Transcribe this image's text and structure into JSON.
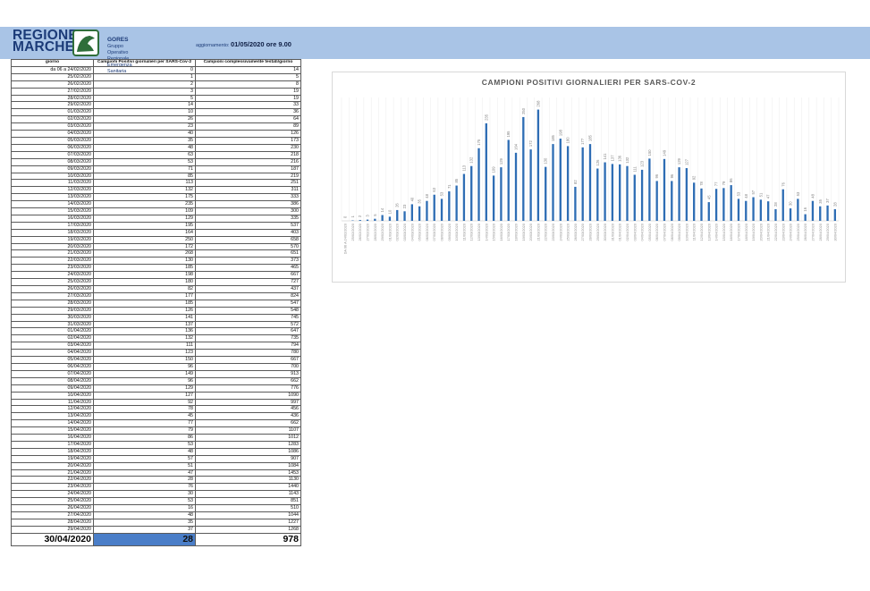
{
  "header": {
    "logo_line1": "REGIONE",
    "logo_line2": "MARCHE",
    "gores_bold": "GORES",
    "gores_rest": "Gruppo Operativo Regionale",
    "gores_line2": "Emergenza Sanitaria",
    "update_label": "aggiornamento:",
    "update_value": "01/05/2020 ore 9.00"
  },
  "colors": {
    "header_bg": "#a9c4e6",
    "bar": "#2e6db4",
    "highlight": "#4a7ec8",
    "logo_blue": "#1c3b78",
    "emblem_green": "#2f6e3a"
  },
  "table": {
    "headers": [
      "giorno",
      "Campioni Positivi giornalieri per SARS-Cov-2",
      "Campioni complessivamente testati/giorno"
    ],
    "rows": [
      [
        "da 06 a 24/02/2020",
        "0",
        "14"
      ],
      [
        "25/02/2020",
        "1",
        "5"
      ],
      [
        "26/02/2020",
        "2",
        "8"
      ],
      [
        "27/02/2020",
        "3",
        "19"
      ],
      [
        "28/02/2020",
        "5",
        "19"
      ],
      [
        "29/02/2020",
        "14",
        "33"
      ],
      [
        "01/03/2020",
        "10",
        "36"
      ],
      [
        "02/03/2020",
        "26",
        "64"
      ],
      [
        "03/03/2020",
        "23",
        "89"
      ],
      [
        "04/03/2020",
        "40",
        "126"
      ],
      [
        "05/03/2020",
        "35",
        "173"
      ],
      [
        "06/03/2020",
        "48",
        "230"
      ],
      [
        "07/03/2020",
        "63",
        "218"
      ],
      [
        "08/03/2020",
        "53",
        "216"
      ],
      [
        "09/03/2020",
        "71",
        "187"
      ],
      [
        "10/03/2020",
        "85",
        "219"
      ],
      [
        "11/03/2020",
        "113",
        "251"
      ],
      [
        "12/03/2020",
        "132",
        "311"
      ],
      [
        "13/03/2020",
        "175",
        "333"
      ],
      [
        "14/03/2020",
        "235",
        "386"
      ],
      [
        "15/03/2020",
        "109",
        "300"
      ],
      [
        "16/03/2020",
        "129",
        "335"
      ],
      [
        "17/03/2020",
        "195",
        "537"
      ],
      [
        "18/03/2020",
        "164",
        "403"
      ],
      [
        "19/03/2020",
        "250",
        "658"
      ],
      [
        "20/03/2020",
        "172",
        "570"
      ],
      [
        "21/03/2020",
        "268",
        "651"
      ],
      [
        "22/03/2020",
        "130",
        "373"
      ],
      [
        "23/03/2020",
        "185",
        "465"
      ],
      [
        "24/03/2020",
        "198",
        "667"
      ],
      [
        "25/03/2020",
        "180",
        "727"
      ],
      [
        "26/03/2020",
        "82",
        "437"
      ],
      [
        "27/03/2020",
        "177",
        "824"
      ],
      [
        "28/03/2020",
        "185",
        "547"
      ],
      [
        "29/03/2020",
        "126",
        "548"
      ],
      [
        "30/03/2020",
        "141",
        "745"
      ],
      [
        "31/03/2020",
        "137",
        "572"
      ],
      [
        "01/04/2020",
        "136",
        "647"
      ],
      [
        "02/04/2020",
        "132",
        "735"
      ],
      [
        "03/04/2020",
        "111",
        "794"
      ],
      [
        "04/04/2020",
        "123",
        "780"
      ],
      [
        "05/04/2020",
        "150",
        "667"
      ],
      [
        "06/04/2020",
        "96",
        "700"
      ],
      [
        "07/04/2020",
        "149",
        "913"
      ],
      [
        "08/04/2020",
        "96",
        "662"
      ],
      [
        "09/04/2020",
        "129",
        "776"
      ],
      [
        "10/04/2020",
        "127",
        "1090"
      ],
      [
        "11/04/2020",
        "92",
        "997"
      ],
      [
        "12/04/2020",
        "78",
        "456"
      ],
      [
        "13/04/2020",
        "45",
        "436"
      ],
      [
        "14/04/2020",
        "77",
        "662"
      ],
      [
        "15/04/2020",
        "79",
        "1107"
      ],
      [
        "16/04/2020",
        "86",
        "1012"
      ],
      [
        "17/04/2020",
        "53",
        "1283"
      ],
      [
        "18/04/2020",
        "48",
        "1086"
      ],
      [
        "19/04/2020",
        "57",
        "907"
      ],
      [
        "20/04/2020",
        "51",
        "1084"
      ],
      [
        "21/04/2020",
        "47",
        "1453"
      ],
      [
        "22/04/2020",
        "28",
        "1130"
      ],
      [
        "23/04/2020",
        "76",
        "1440"
      ],
      [
        "24/04/2020",
        "30",
        "1143"
      ],
      [
        "25/04/2020",
        "53",
        "851"
      ],
      [
        "26/04/2020",
        "16",
        "510"
      ],
      [
        "27/04/2020",
        "48",
        "1044"
      ],
      [
        "28/04/2020",
        "35",
        "1227"
      ],
      [
        "29/04/2020",
        "37",
        "1268"
      ]
    ],
    "last_row": [
      "30/04/2020",
      "28",
      "978"
    ]
  },
  "chart_data": {
    "type": "bar",
    "title": "CAMPIONI POSITIVI GIORNALIERI PER SARS-COV-2",
    "xlabel": "",
    "ylabel": "",
    "grid": true,
    "data_labels": true,
    "categories": [
      "DA 06 A 24/02/2020",
      "25/02/2020",
      "26/02/2020",
      "27/02/2020",
      "28/02/2020",
      "29/02/2020",
      "01/03/2020",
      "02/03/2020",
      "03/03/2020",
      "04/03/2020",
      "05/03/2020",
      "06/03/2020",
      "07/03/2020",
      "08/03/2020",
      "09/03/2020",
      "10/03/2020",
      "11/03/2020",
      "12/03/2020",
      "13/03/2020",
      "14/03/2020",
      "15/03/2020",
      "16/03/2020",
      "17/03/2020",
      "18/03/2020",
      "19/03/2020",
      "20/03/2020",
      "21/03/2020",
      "22/03/2020",
      "23/03/2020",
      "24/03/2020",
      "25/03/2020",
      "26/03/2020",
      "27/03/2020",
      "28/03/2020",
      "29/03/2020",
      "30/03/2020",
      "31/03/2020",
      "01/04/2020",
      "02/04/2020",
      "03/04/2020",
      "04/04/2020",
      "05/04/2020",
      "06/04/2020",
      "07/04/2020",
      "08/04/2020",
      "09/04/2020",
      "10/04/2020",
      "11/04/2020",
      "12/04/2020",
      "13/04/2020",
      "14/04/2020",
      "15/04/2020",
      "16/04/2020",
      "17/04/2020",
      "18/04/2020",
      "19/04/2020",
      "20/04/2020",
      "21/04/2020",
      "22/04/2020",
      "23/04/2020",
      "24/04/2020",
      "25/04/2020",
      "26/04/2020",
      "27/04/2020",
      "28/04/2020",
      "29/04/2020",
      "30/04/2020"
    ],
    "values": [
      0,
      1,
      2,
      3,
      5,
      14,
      10,
      26,
      23,
      40,
      35,
      48,
      63,
      53,
      71,
      85,
      113,
      132,
      175,
      235,
      109,
      129,
      195,
      164,
      250,
      172,
      268,
      130,
      185,
      198,
      180,
      82,
      177,
      185,
      126,
      141,
      137,
      136,
      132,
      111,
      123,
      150,
      96,
      149,
      96,
      129,
      127,
      92,
      78,
      45,
      77,
      79,
      86,
      53,
      48,
      57,
      51,
      47,
      28,
      76,
      30,
      53,
      16,
      48,
      35,
      37,
      28
    ]
  }
}
